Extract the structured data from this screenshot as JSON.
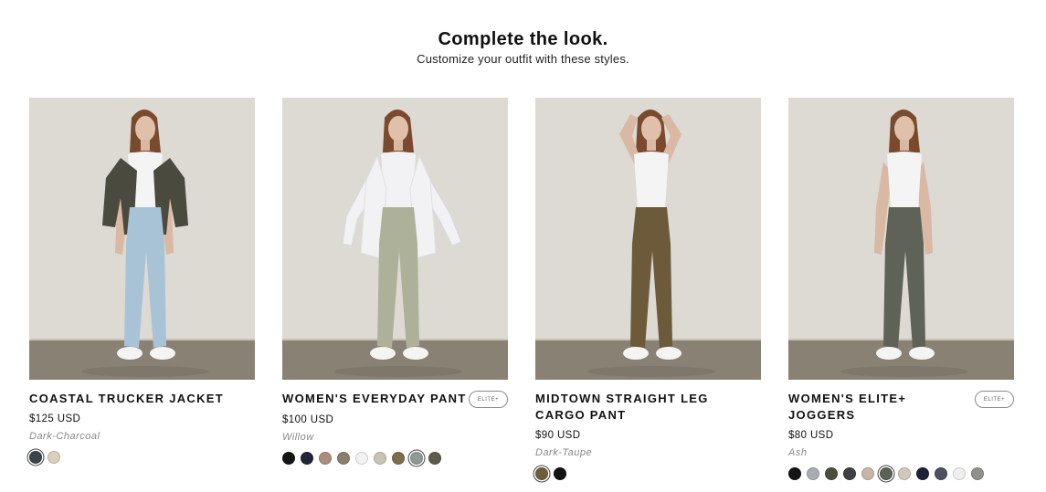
{
  "section": {
    "title": "Complete the look.",
    "subtitle": "Customize your outfit with these styles."
  },
  "products": [
    {
      "name": "COASTAL TRUCKER JACKET",
      "price": "$125 USD",
      "color_name": "Dark-Charcoal",
      "badge": "",
      "top_color": "#4a4b3e",
      "bottom_color": "#a9c3d6",
      "swatches": [
        {
          "color": "#3d4449",
          "selected": true
        },
        {
          "color": "#dccfbd",
          "selected": false
        }
      ]
    },
    {
      "name": "WOMEN'S EVERYDAY PANT",
      "price": "$100 USD",
      "color_name": "Willow",
      "badge": "ELITE+",
      "top_color": "#f2f2f4",
      "bottom_color": "#aeb199",
      "swatches": [
        {
          "color": "#151515",
          "selected": false
        },
        {
          "color": "#23253a",
          "selected": false
        },
        {
          "color": "#a98f7c",
          "selected": false
        },
        {
          "color": "#8a7f6c",
          "selected": false
        },
        {
          "color": "#f2f2f2",
          "selected": false
        },
        {
          "color": "#c9c3b4",
          "selected": false
        },
        {
          "color": "#7a6d4b",
          "selected": false
        },
        {
          "color": "#8f9a93",
          "selected": true
        },
        {
          "color": "#5d5b4a",
          "selected": false
        }
      ]
    },
    {
      "name": "MIDTOWN STRAIGHT LEG CARGO PANT",
      "price": "$90 USD",
      "color_name": "Dark-Taupe",
      "badge": "",
      "top_color": "#f4f4f4",
      "bottom_color": "#6c5a3a",
      "swatches": [
        {
          "color": "#6d5f3e",
          "selected": true
        },
        {
          "color": "#131313",
          "selected": false
        }
      ]
    },
    {
      "name": "WOMEN'S ELITE+ JOGGERS",
      "price": "$80 USD",
      "color_name": "Ash",
      "badge": "ELITE+",
      "top_color": "#f4f4f4",
      "bottom_color": "#5f6256",
      "swatches": [
        {
          "color": "#151515",
          "selected": false
        },
        {
          "color": "#a9acb3",
          "selected": false
        },
        {
          "color": "#4a4e3d",
          "selected": false
        },
        {
          "color": "#3f4142",
          "selected": false
        },
        {
          "color": "#c8b5a7",
          "selected": false
        },
        {
          "color": "#5c6258",
          "selected": true
        },
        {
          "color": "#cfc9bc",
          "selected": false
        },
        {
          "color": "#1f2138",
          "selected": false
        },
        {
          "color": "#4c5060",
          "selected": false
        },
        {
          "color": "#efeff0",
          "selected": false
        },
        {
          "color": "#8f918c",
          "selected": false
        }
      ]
    }
  ]
}
